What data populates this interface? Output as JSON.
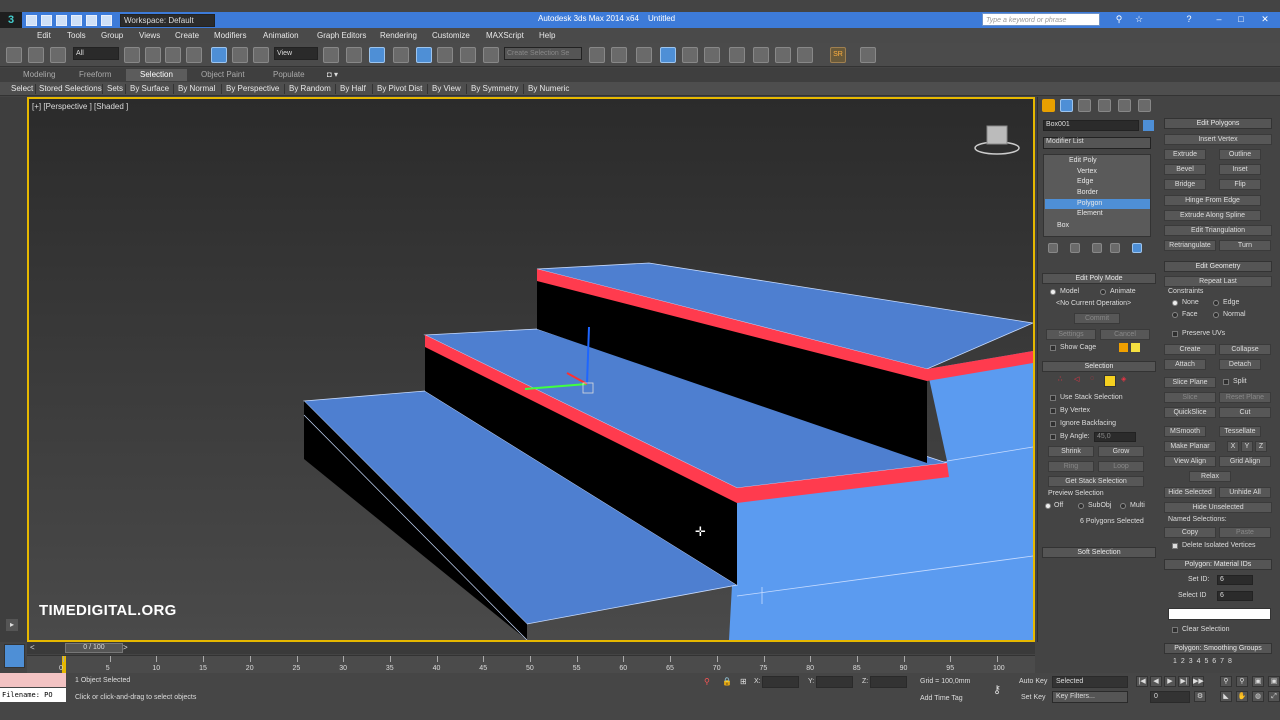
{
  "titlebar": {
    "workspace": "Workspace: Default",
    "app_title": "Autodesk 3ds Max 2014 x64",
    "doc_title": "Untitled",
    "search_placeholder": "Type a keyword or phrase"
  },
  "menu": [
    "Edit",
    "Tools",
    "Group",
    "Views",
    "Create",
    "Modifiers",
    "Animation",
    "Graph Editors",
    "Rendering",
    "Customize",
    "MAXScript",
    "Help"
  ],
  "toolbar": {
    "filter_value": "All",
    "ref_coord": "View",
    "named_sel_placeholder": "Create Selection Se"
  },
  "ribbon": {
    "tabs": [
      "Modeling",
      "Freeform",
      "Selection",
      "Object Paint",
      "Populate"
    ],
    "active_tab": "Selection",
    "row": [
      "Select",
      "Stored Selections",
      "Sets",
      "By Surface",
      "By Normal",
      "By Perspective",
      "By Random",
      "By Half",
      "By Pivot Dist",
      "By View",
      "By Symmetry",
      "By Numeric"
    ]
  },
  "viewport": {
    "label": "[+] [Perspective ] [Shaded ]",
    "watermark": "TIMEDIGITAL.ORG",
    "colors": {
      "blue_face": "#4e7fd0",
      "red_edge": "#ff3b4e",
      "riser": "#000000",
      "side": "#5b9bf0",
      "border": "#e6b800"
    }
  },
  "command_panel": {
    "object_name": "Box001",
    "modifier_list": "Modifier List",
    "stack": [
      "Edit Poly",
      "Vertex",
      "Edge",
      "Border",
      "Polygon",
      "Element",
      "Box"
    ],
    "stack_selected": "Polygon",
    "edit_poly_mode": {
      "title": "Edit Poly Mode",
      "model": "Model",
      "animate": "Animate",
      "no_op": "<No Current Operation>",
      "commit": "Commit",
      "settings": "Settings",
      "cancel": "Cancel",
      "show_cage": "Show Cage"
    },
    "selection": {
      "title": "Selection",
      "use_stack": "Use Stack Selection",
      "by_vertex": "By Vertex",
      "ignore_backfacing": "Ignore Backfacing",
      "by_angle": "By Angle:",
      "angle_value": "45,0",
      "shrink": "Shrink",
      "grow": "Grow",
      "ring": "Ring",
      "loop": "Loop",
      "get_stack": "Get Stack Selection",
      "preview": "Preview Selection",
      "off": "Off",
      "subobj": "SubObj",
      "multi": "Multi",
      "count": "6 Polygons Selected"
    },
    "soft_selection": "Soft Selection"
  },
  "right_panel": {
    "edit_polygons": {
      "title": "Edit Polygons",
      "insert_vertex": "Insert Vertex",
      "extrude": "Extrude",
      "outline": "Outline",
      "bevel": "Bevel",
      "inset": "Inset",
      "bridge": "Bridge",
      "flip": "Flip",
      "hinge": "Hinge From Edge",
      "extrude_spline": "Extrude Along Spline",
      "edit_tri": "Edit Triangulation",
      "retriangulate": "Retriangulate",
      "turn": "Turn"
    },
    "edit_geometry": {
      "title": "Edit Geometry",
      "repeat_last": "Repeat Last",
      "constraints": "Constraints",
      "none": "None",
      "edge": "Edge",
      "face": "Face",
      "normal": "Normal",
      "preserve_uvs": "Preserve UVs",
      "create": "Create",
      "collapse": "Collapse",
      "attach": "Attach",
      "detach": "Detach",
      "slice_plane": "Slice Plane",
      "split": "Split",
      "slice": "Slice",
      "reset_plane": "Reset Plane",
      "quickslice": "QuickSlice",
      "cut": "Cut",
      "msmooth": "MSmooth",
      "tessellate": "Tessellate",
      "make_planar": "Make Planar",
      "x": "X",
      "y": "Y",
      "z": "Z",
      "view_align": "View Align",
      "grid_align": "Grid Align",
      "relax": "Relax",
      "hide_selected": "Hide Selected",
      "unhide_all": "Unhide All",
      "hide_unselected": "Hide Unselected",
      "named_selections": "Named Selections:",
      "copy": "Copy",
      "paste": "Paste",
      "delete_isolated": "Delete Isolated Vertices"
    },
    "material_ids": {
      "title": "Polygon: Material IDs",
      "set_id": "Set ID:",
      "set_id_value": "6",
      "select_id": "Select ID",
      "select_id_value": "6",
      "clear_selection": "Clear Selection"
    },
    "smoothing": {
      "title": "Polygon: Smoothing Groups",
      "groups": [
        "1",
        "2",
        "3",
        "4",
        "5",
        "6",
        "7",
        "8"
      ]
    }
  },
  "timeline": {
    "slider_label": "0 / 100",
    "ticks": [
      "0",
      "5",
      "10",
      "15",
      "20",
      "25",
      "30",
      "35",
      "40",
      "45",
      "50",
      "55",
      "60",
      "65",
      "70",
      "75",
      "80",
      "85",
      "90",
      "95",
      "100"
    ]
  },
  "status": {
    "selection_count": "1 Object Selected",
    "prompt": "Click or click-and-drag to select objects",
    "x_label": "X:",
    "y_label": "Y:",
    "z_label": "Z:",
    "grid": "Grid = 100,0mm",
    "add_time_tag": "Add Time Tag",
    "auto_key": "Auto Key",
    "set_key": "Set Key",
    "key_mode": "Selected",
    "key_filters": "Key Filters...",
    "frame": "0",
    "filename": "Filename: PO"
  }
}
